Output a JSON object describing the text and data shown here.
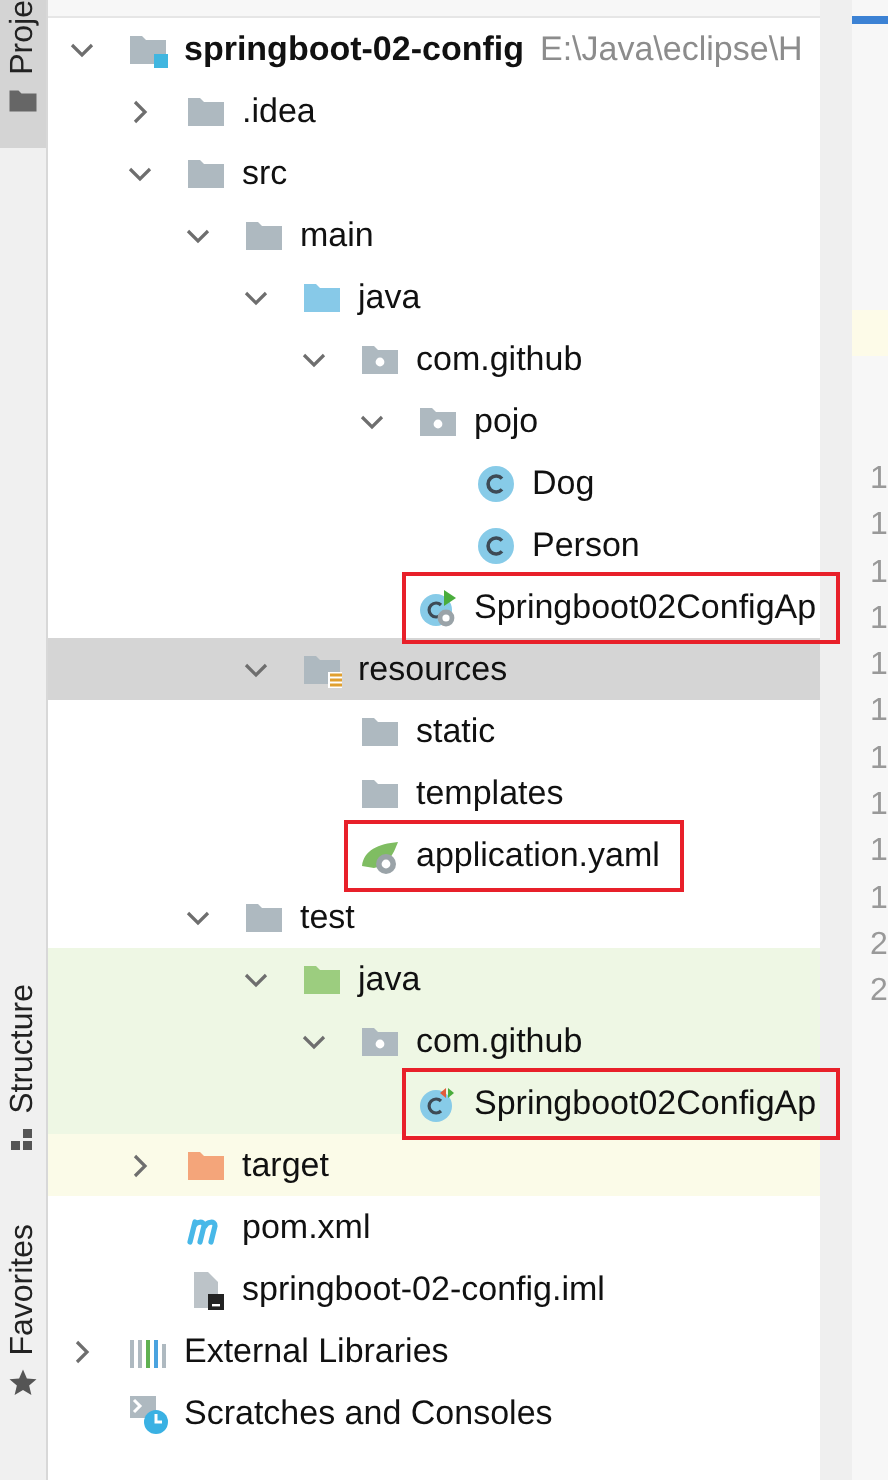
{
  "tool_tabs": [
    {
      "label": "Proje",
      "kind": "project",
      "selected": true
    },
    {
      "label": "Structure",
      "kind": "structure",
      "selected": false
    },
    {
      "label": "Favorites",
      "kind": "favorites",
      "selected": false
    }
  ],
  "tree": [
    {
      "label": "springboot-02-config",
      "kind": "module",
      "location": "E:\\Java\\eclipse\\H",
      "expanded": true,
      "selected": false,
      "children": [
        {
          "label": ".idea",
          "kind": "folder",
          "expanded": false,
          "selected": false
        },
        {
          "label": "src",
          "kind": "folder",
          "expanded": true,
          "selected": false,
          "children": [
            {
              "label": "main",
              "kind": "folder",
              "expanded": true,
              "selected": false,
              "children": [
                {
                  "label": "java",
                  "kind": "source_root",
                  "expanded": true,
                  "selected": false,
                  "children": [
                    {
                      "label": "com.github",
                      "kind": "package",
                      "expanded": true,
                      "selected": false,
                      "children": [
                        {
                          "label": "pojo",
                          "kind": "package",
                          "expanded": true,
                          "selected": false,
                          "children": [
                            {
                              "label": "Dog",
                              "kind": "class",
                              "selected": false
                            },
                            {
                              "label": "Person",
                              "kind": "class",
                              "selected": false
                            }
                          ]
                        },
                        {
                          "label": "Springboot02ConfigAp",
                          "kind": "spring_class",
                          "selected": false,
                          "annotated": true
                        }
                      ]
                    }
                  ]
                },
                {
                  "label": "resources",
                  "kind": "resources_root",
                  "expanded": true,
                  "selected": true,
                  "children": [
                    {
                      "label": "static",
                      "kind": "folder",
                      "selected": false
                    },
                    {
                      "label": "templates",
                      "kind": "folder",
                      "selected": false
                    },
                    {
                      "label": "application.yaml",
                      "kind": "spring_yaml",
                      "selected": false,
                      "annotated": true
                    }
                  ]
                }
              ]
            },
            {
              "label": "test",
              "kind": "folder",
              "expanded": true,
              "selected": false,
              "children": [
                {
                  "label": "java",
                  "kind": "test_root",
                  "expanded": true,
                  "selected": false,
                  "test_scope": true,
                  "children": [
                    {
                      "label": "com.github",
                      "kind": "package",
                      "expanded": true,
                      "selected": false,
                      "test_scope": true,
                      "children": [
                        {
                          "label": "Springboot02ConfigAp",
                          "kind": "test_class",
                          "selected": false,
                          "test_scope": true,
                          "annotated": true
                        }
                      ]
                    }
                  ]
                }
              ]
            }
          ]
        },
        {
          "label": "target",
          "kind": "excluded",
          "expanded": false,
          "selected": false,
          "excluded": true
        },
        {
          "label": "pom.xml",
          "kind": "maven",
          "selected": false
        },
        {
          "label": "springboot-02-config.iml",
          "kind": "iml",
          "selected": false
        }
      ]
    },
    {
      "label": "External Libraries",
      "kind": "libraries",
      "expanded": false,
      "selected": false
    },
    {
      "label": "Scratches and Consoles",
      "kind": "scratches",
      "selected": false
    }
  ],
  "editor_gutter": {
    "line_numbers": [
      "1",
      "1",
      "1",
      "1",
      "1",
      "1",
      "1",
      "1",
      "1",
      "1",
      "2",
      "2"
    ]
  }
}
